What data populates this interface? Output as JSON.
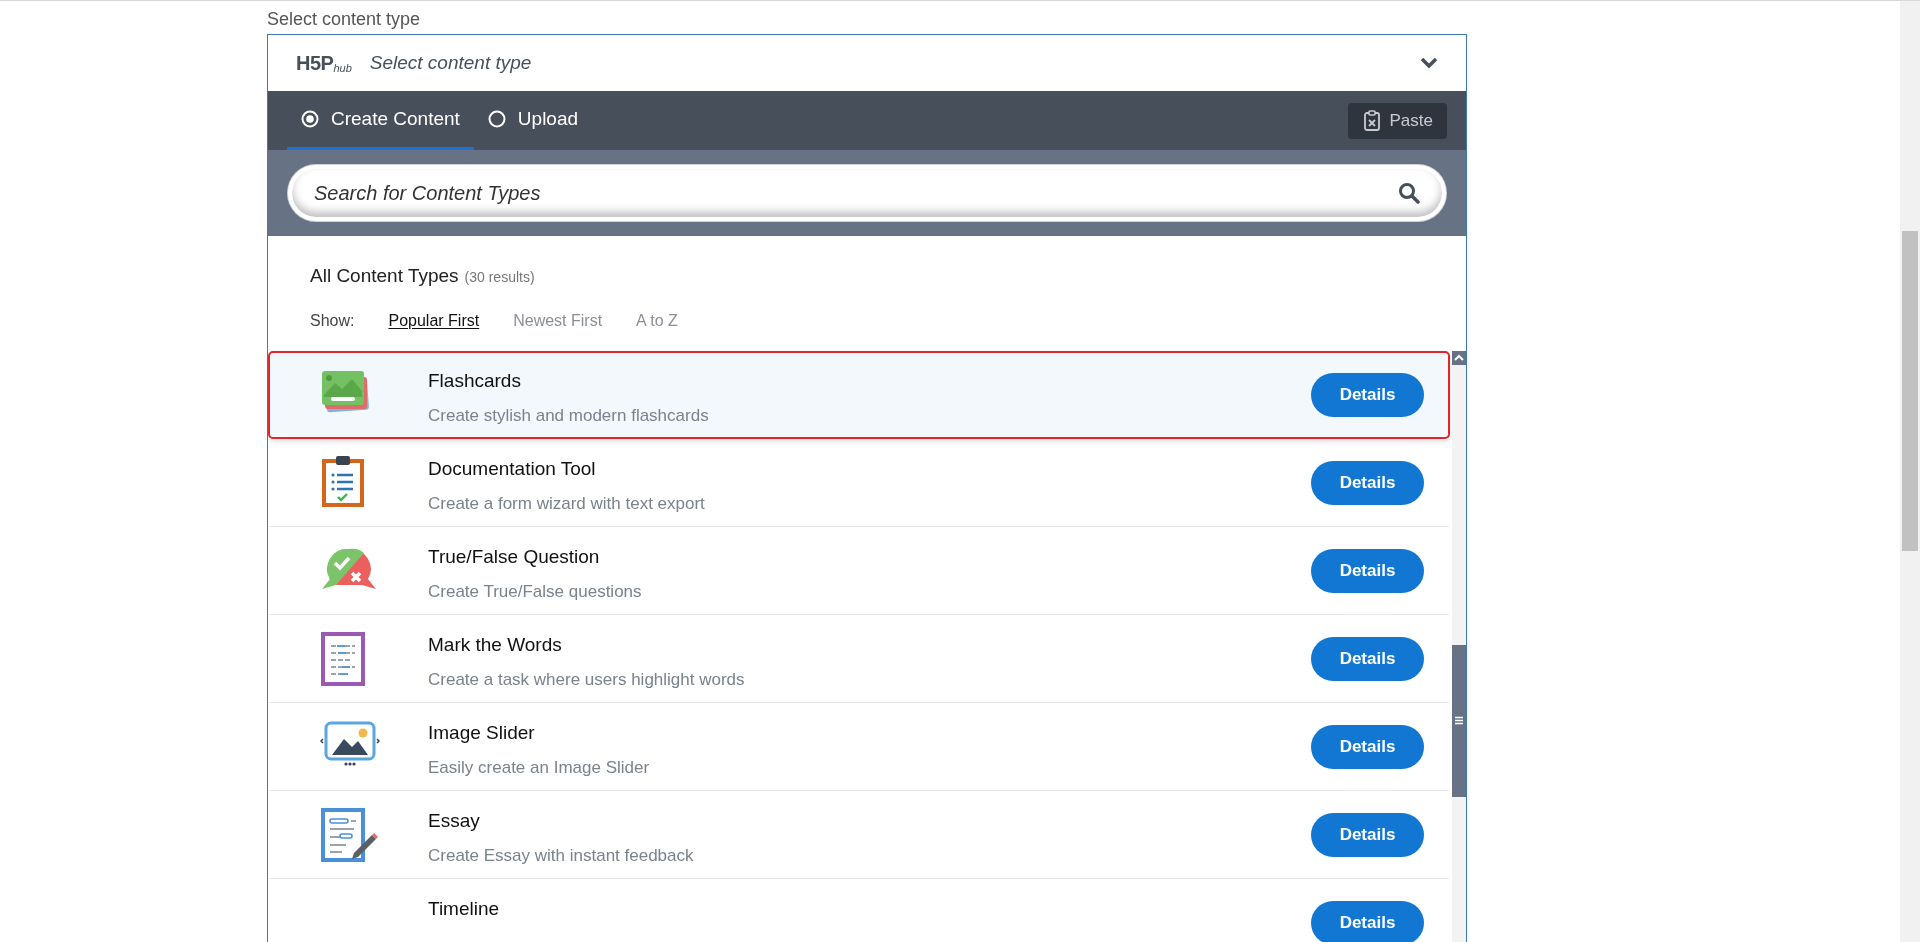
{
  "field_label": "Select content type",
  "hub": {
    "logo": "H5P",
    "logo_sub": "hub",
    "title": "Select content type",
    "expanded": true
  },
  "tabs": [
    {
      "label": "Create Content",
      "selected": true
    },
    {
      "label": "Upload",
      "selected": false
    }
  ],
  "paste_button": "Paste",
  "search": {
    "placeholder": "Search for Content Types"
  },
  "heading": "All Content Types",
  "result_count": "(30 results)",
  "sort": {
    "label": "Show:",
    "options": [
      {
        "label": "Popular First",
        "selected": true
      },
      {
        "label": "Newest First",
        "selected": false
      },
      {
        "label": "A to Z",
        "selected": false
      }
    ]
  },
  "content_types": [
    {
      "title": "Flashcards",
      "description": "Create stylish and modern flashcards",
      "button": "Details",
      "selected": true
    },
    {
      "title": "Documentation Tool",
      "description": "Create a form wizard with text export",
      "button": "Details",
      "selected": false
    },
    {
      "title": "True/False Question",
      "description": "Create True/False questions",
      "button": "Details",
      "selected": false
    },
    {
      "title": "Mark the Words",
      "description": "Create a task where users highlight words",
      "button": "Details",
      "selected": false
    },
    {
      "title": "Image Slider",
      "description": "Easily create an Image Slider",
      "button": "Details",
      "selected": false
    },
    {
      "title": "Essay",
      "description": "Create Essay with instant feedback",
      "button": "Details",
      "selected": false
    },
    {
      "title": "Timeline",
      "button": "Details",
      "selected": false
    }
  ]
}
